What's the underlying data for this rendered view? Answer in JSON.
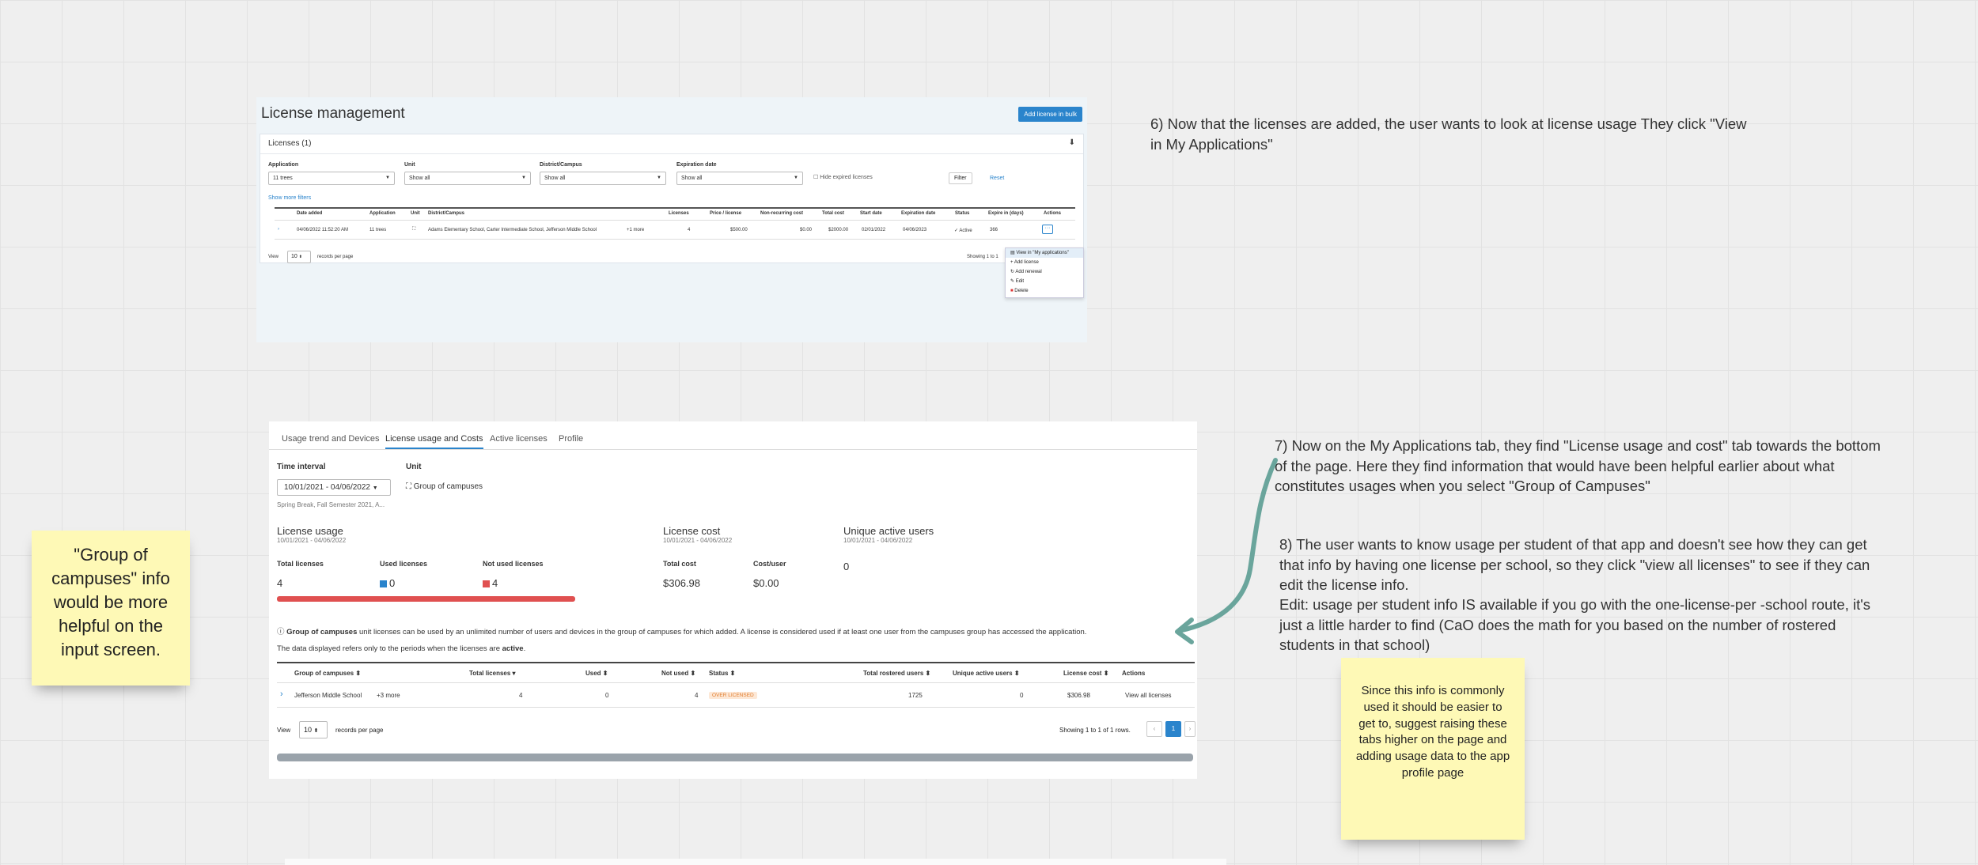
{
  "shot1": {
    "title": "License management",
    "add_bulk_label": "Add license in bulk",
    "licenses_header": "Licenses (1)",
    "download_icon": "download-icon",
    "filters": {
      "application": {
        "label": "Application",
        "value": "11 trees"
      },
      "unit": {
        "label": "Unit",
        "value": "Show all"
      },
      "district": {
        "label": "District/Campus",
        "value": "Show all"
      },
      "expiration": {
        "label": "Expiration date",
        "value": "Show all"
      },
      "hide_expired": "Hide expired licenses",
      "filter_button": "Filter",
      "reset_link": "Reset",
      "show_more": "Show more filters"
    },
    "columns": [
      "Date added",
      "Application",
      "Unit",
      "District/Campus",
      "Licenses",
      "Price / license",
      "Non-recurring cost",
      "Total cost",
      "Start date",
      "Expiration date",
      "Status",
      "Expire in (days)",
      "Actions"
    ],
    "row": {
      "date_added": "04/06/2022 11:52:20 AM",
      "application": "11 trees",
      "district": "Adams Elementary School, Carter Intermediate School, Jefferson Middle School",
      "more": "+1 more",
      "licenses": "4",
      "price": "$500.00",
      "non_recurring": "$0.00",
      "total_cost": "$2000.00",
      "start_date": "02/01/2022",
      "expiration_date": "04/06/2023",
      "status": "Active",
      "expire_in": "366"
    },
    "view_label": "View",
    "per_page_value": "10",
    "per_page_label": "records per page",
    "showing": "Showing 1 to 1",
    "actions_menu": [
      "View in \"My applications\"",
      "Add license",
      "Add renewal",
      "Edit",
      "Delete"
    ]
  },
  "shot2": {
    "tabs": [
      "Usage trend and Devices",
      "License usage and Costs",
      "Active licenses",
      "Profile"
    ],
    "time_interval_label": "Time interval",
    "time_interval_value": "10/01/2021 - 04/06/2022",
    "time_interval_sub": "Spring Break, Fall Semester 2021, A...",
    "unit_label": "Unit",
    "unit_value": "Group of campuses",
    "license_usage": {
      "title": "License usage",
      "range": "10/01/2021 - 04/06/2022"
    },
    "license_cost": {
      "title": "License cost",
      "range": "10/01/2021 - 04/06/2022"
    },
    "unique_users": {
      "title": "Unique active users",
      "range": "10/01/2021 - 04/06/2022",
      "value": "0"
    },
    "total_licenses": {
      "label": "Total licenses",
      "value": "4"
    },
    "used_licenses": {
      "label": "Used licenses",
      "value": "0"
    },
    "not_used_licenses": {
      "label": "Not used licenses",
      "value": "4"
    },
    "total_cost": {
      "label": "Total cost",
      "value": "$306.98"
    },
    "cost_per_user": {
      "label": "Cost/user",
      "value": "$0.00"
    },
    "usage_bar_used_fraction": 0,
    "info_bold": "Group of campuses",
    "info_text": "unit licenses can be used by an unlimited number of users and devices in the group of campuses for which added. A license is considered used if at least one user from the campuses group has accessed the application.",
    "periods_text": "The data displayed refers only to the periods when the licenses are",
    "periods_bold": "active",
    "columns": [
      "Group of campuses",
      "Total licenses",
      "Used",
      "Not used",
      "Status",
      "Total rostered users",
      "Unique active users",
      "License cost",
      "Actions"
    ],
    "row": {
      "group": "Jefferson Middle School",
      "more": "+3 more",
      "total": "4",
      "used": "0",
      "not_used": "4",
      "status": "OVER LICENSED",
      "rostered": "1725",
      "unique": "0",
      "cost": "$306.98",
      "action": "View all licenses"
    },
    "view_label": "View",
    "per_page_value": "10",
    "per_page_label": "records per page",
    "showing": "Showing 1 to 1 of 1 rows.",
    "page": "1",
    "colors": {
      "accent": "#2a84cc",
      "used": "#2a84cc",
      "not_used": "#e05050",
      "bar": "#e05050"
    }
  },
  "notes": {
    "n6": "6) Now that the licenses are added, the user wants to look at license usage They click \"View in My Applications\"",
    "n7": "7) Now on the My Applications tab, they find \"License usage and cost\" tab towards the bottom of the page.  Here they find information that would have been helpful earlier about what constitutes usages when you select \"Group of Campuses\"",
    "n8": "8) The user wants to know usage per student of that app and doesn't see how they can get that info by having one license per school, so they click \"view all licenses\" to see if they can edit the license info.",
    "n8_edit": "Edit: usage per student info IS available if you go with the one-license-per -school route, it's just a little harder to find (CaO does the math for you based on the number of rostered students in that school)",
    "sticky_left": "\"Group of campuses\" info would be more helpful on the input screen.",
    "sticky_right": "Since this info is commonly used it should be easier to get to, suggest raising these tabs higher on the page and adding usage data to the app profile page"
  }
}
